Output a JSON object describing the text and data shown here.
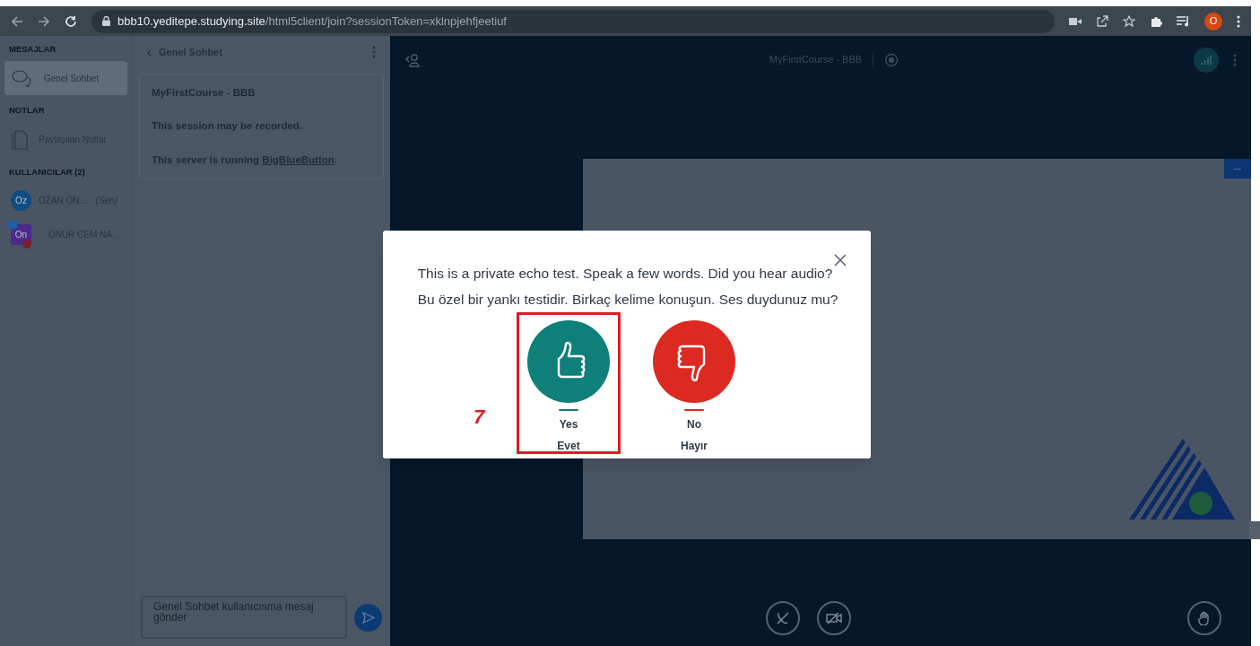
{
  "browser": {
    "url_host": "bbb10.yeditepe.studying.site",
    "url_path": "/html5client/join?sessionToken=xklnpjehfjeetiuf",
    "profile": "O"
  },
  "sidebar": {
    "sections": [
      {
        "heading": "MESAJLAR",
        "items": [
          {
            "kind": "chat",
            "label": "Genel Sohbet",
            "selected": true
          }
        ]
      },
      {
        "heading": "NOTLAR",
        "items": [
          {
            "kind": "notes",
            "label": "Paylaşılan Notlar",
            "selected": false
          }
        ]
      },
      {
        "heading": "KULLANICILAR (2)",
        "users": [
          {
            "initials": "Oz",
            "name": "OZAN ON…",
            "tag": "(Sen)",
            "color": "#0f4c81",
            "presenter": false
          },
          {
            "initials": "On",
            "name": "ONUR CEM NA…",
            "color": "#4b2a8a",
            "presenter": true
          }
        ]
      }
    ]
  },
  "chat": {
    "title": "Genel Sohbet",
    "welcome": [
      {
        "text": "MyFirstCourse - BBB"
      },
      {
        "text": "This session may be recorded."
      },
      {
        "text": "This server is running ",
        "link": "BigBlueButton",
        "after": "."
      }
    ],
    "input": {
      "placeholder": "Genel Sohbet kullanıcısma mesaj gönder"
    }
  },
  "main": {
    "title": "MyFirstCourse - BBB"
  },
  "modal": {
    "lines": [
      "This is a private echo test. Speak a few words. Did you hear audio?",
      "Bu özel bir yankı testidir. Birkaç kelime konuşun. Ses duydunuz mu?"
    ],
    "buttons": [
      {
        "kind": "yes",
        "label": "Yes",
        "sublabel": "Evet",
        "highlighted": true
      },
      {
        "kind": "no",
        "label": "No",
        "sublabel": "Hayır",
        "highlighted": false
      }
    ],
    "annotation": "7"
  }
}
